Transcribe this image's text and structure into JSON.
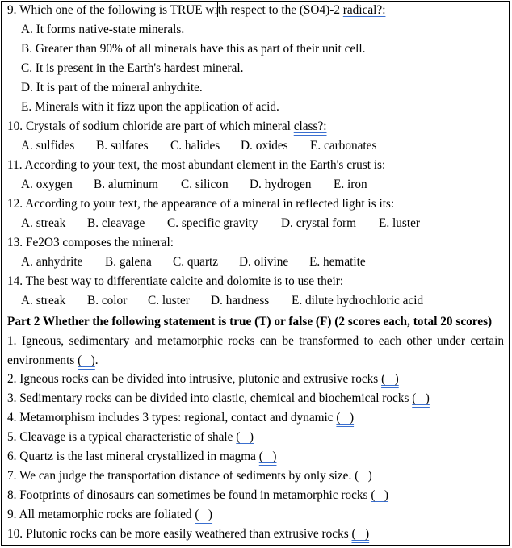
{
  "part1": {
    "questions": [
      {
        "stem_before_cursor": "9. Which one of the following is TRUE wi",
        "stem_after_cursor": "th respect to the (SO4)-2 ",
        "stem_flagged": "radical?:",
        "options_layout": "vertical",
        "options": [
          "A. It forms native-state minerals.",
          "B. Greater than 90% of all minerals have this as part of their unit cell.",
          "C. It is present in the Earth's hardest mineral.",
          "D. It is part of the mineral anhydrite.",
          "E. Minerals with it fizz upon the application of acid."
        ]
      },
      {
        "stem": "10. Crystals of sodium chloride are part of which mineral ",
        "stem_flagged": "class?:",
        "options_layout": "inline",
        "options": [
          "A. sulfides",
          "B. sulfates",
          "C. halides",
          "D. oxides",
          "E. carbonates"
        ]
      },
      {
        "stem": "11. According to your text, the most abundant element in the Earth's crust is:",
        "options_layout": "inline",
        "options": [
          "A. oxygen",
          "B. aluminum",
          "C. silicon",
          "D. hydrogen",
          "E. iron"
        ]
      },
      {
        "stem": "12. According to your text, the appearance of a mineral in reflected light is its:",
        "options_layout": "inline",
        "options": [
          "A. streak",
          "B. cleavage",
          "C. specific gravity",
          "D. crystal form",
          "E. luster"
        ]
      },
      {
        "stem": "13. Fe2O3 composes the mineral:",
        "options_layout": "inline",
        "options": [
          "A. anhydrite",
          "B. galena",
          "C. quartz",
          "D. olivine",
          "E. hematite"
        ]
      },
      {
        "stem": "14. The best way to differentiate calcite and dolomite is to use their:",
        "options_layout": "inline",
        "options": [
          "A. streak",
          "B. color",
          "C. luster",
          "D. hardness",
          "E. dilute hydrochloric acid"
        ]
      }
    ]
  },
  "part2": {
    "heading": "Part 2 Whether the following statement is true (T) or false (F) (2 scores each, total 20 scores)",
    "statements": [
      {
        "text": "1. Igneous, sedimentary and metamorphic rocks can be transformed to each other under certain environments ",
        "blank": "(   )",
        "suffix": ".",
        "flagged": true
      },
      {
        "text": "2. Igneous rocks can be divided into intrusive, plutonic and extrusive rocks ",
        "blank": "(   )",
        "suffix": "",
        "flagged": true
      },
      {
        "text": "3. Sedimentary rocks can be divided into clastic, chemical and biochemical rocks ",
        "blank": "(   )",
        "suffix": "",
        "flagged": true
      },
      {
        "text": "4. Metamorphism includes 3 types: regional, contact and dynamic ",
        "blank": "(   )",
        "suffix": "",
        "flagged": true
      },
      {
        "text": "5. Cleavage is a typical characteristic of shale ",
        "blank": "(   )",
        "suffix": "",
        "flagged": true
      },
      {
        "text": "6. Quartz is the last mineral crystallized in magma ",
        "blank": "(   )",
        "suffix": "",
        "flagged": true
      },
      {
        "text": "7. We can judge the transportation distance of sediments by only size. ",
        "blank": "(   )",
        "suffix": "",
        "flagged": false
      },
      {
        "text": "8. Footprints of dinosaurs can sometimes be found in metamorphic rocks ",
        "blank": "(   )",
        "suffix": "",
        "flagged": true
      },
      {
        "text": "9. All metamorphic rocks are foliated ",
        "blank": "(   )",
        "suffix": "",
        "flagged": true
      },
      {
        "text": "10. Plutonic rocks can be more easily weathered than extrusive rocks ",
        "blank": "(   )",
        "suffix": "",
        "flagged": true
      }
    ]
  }
}
